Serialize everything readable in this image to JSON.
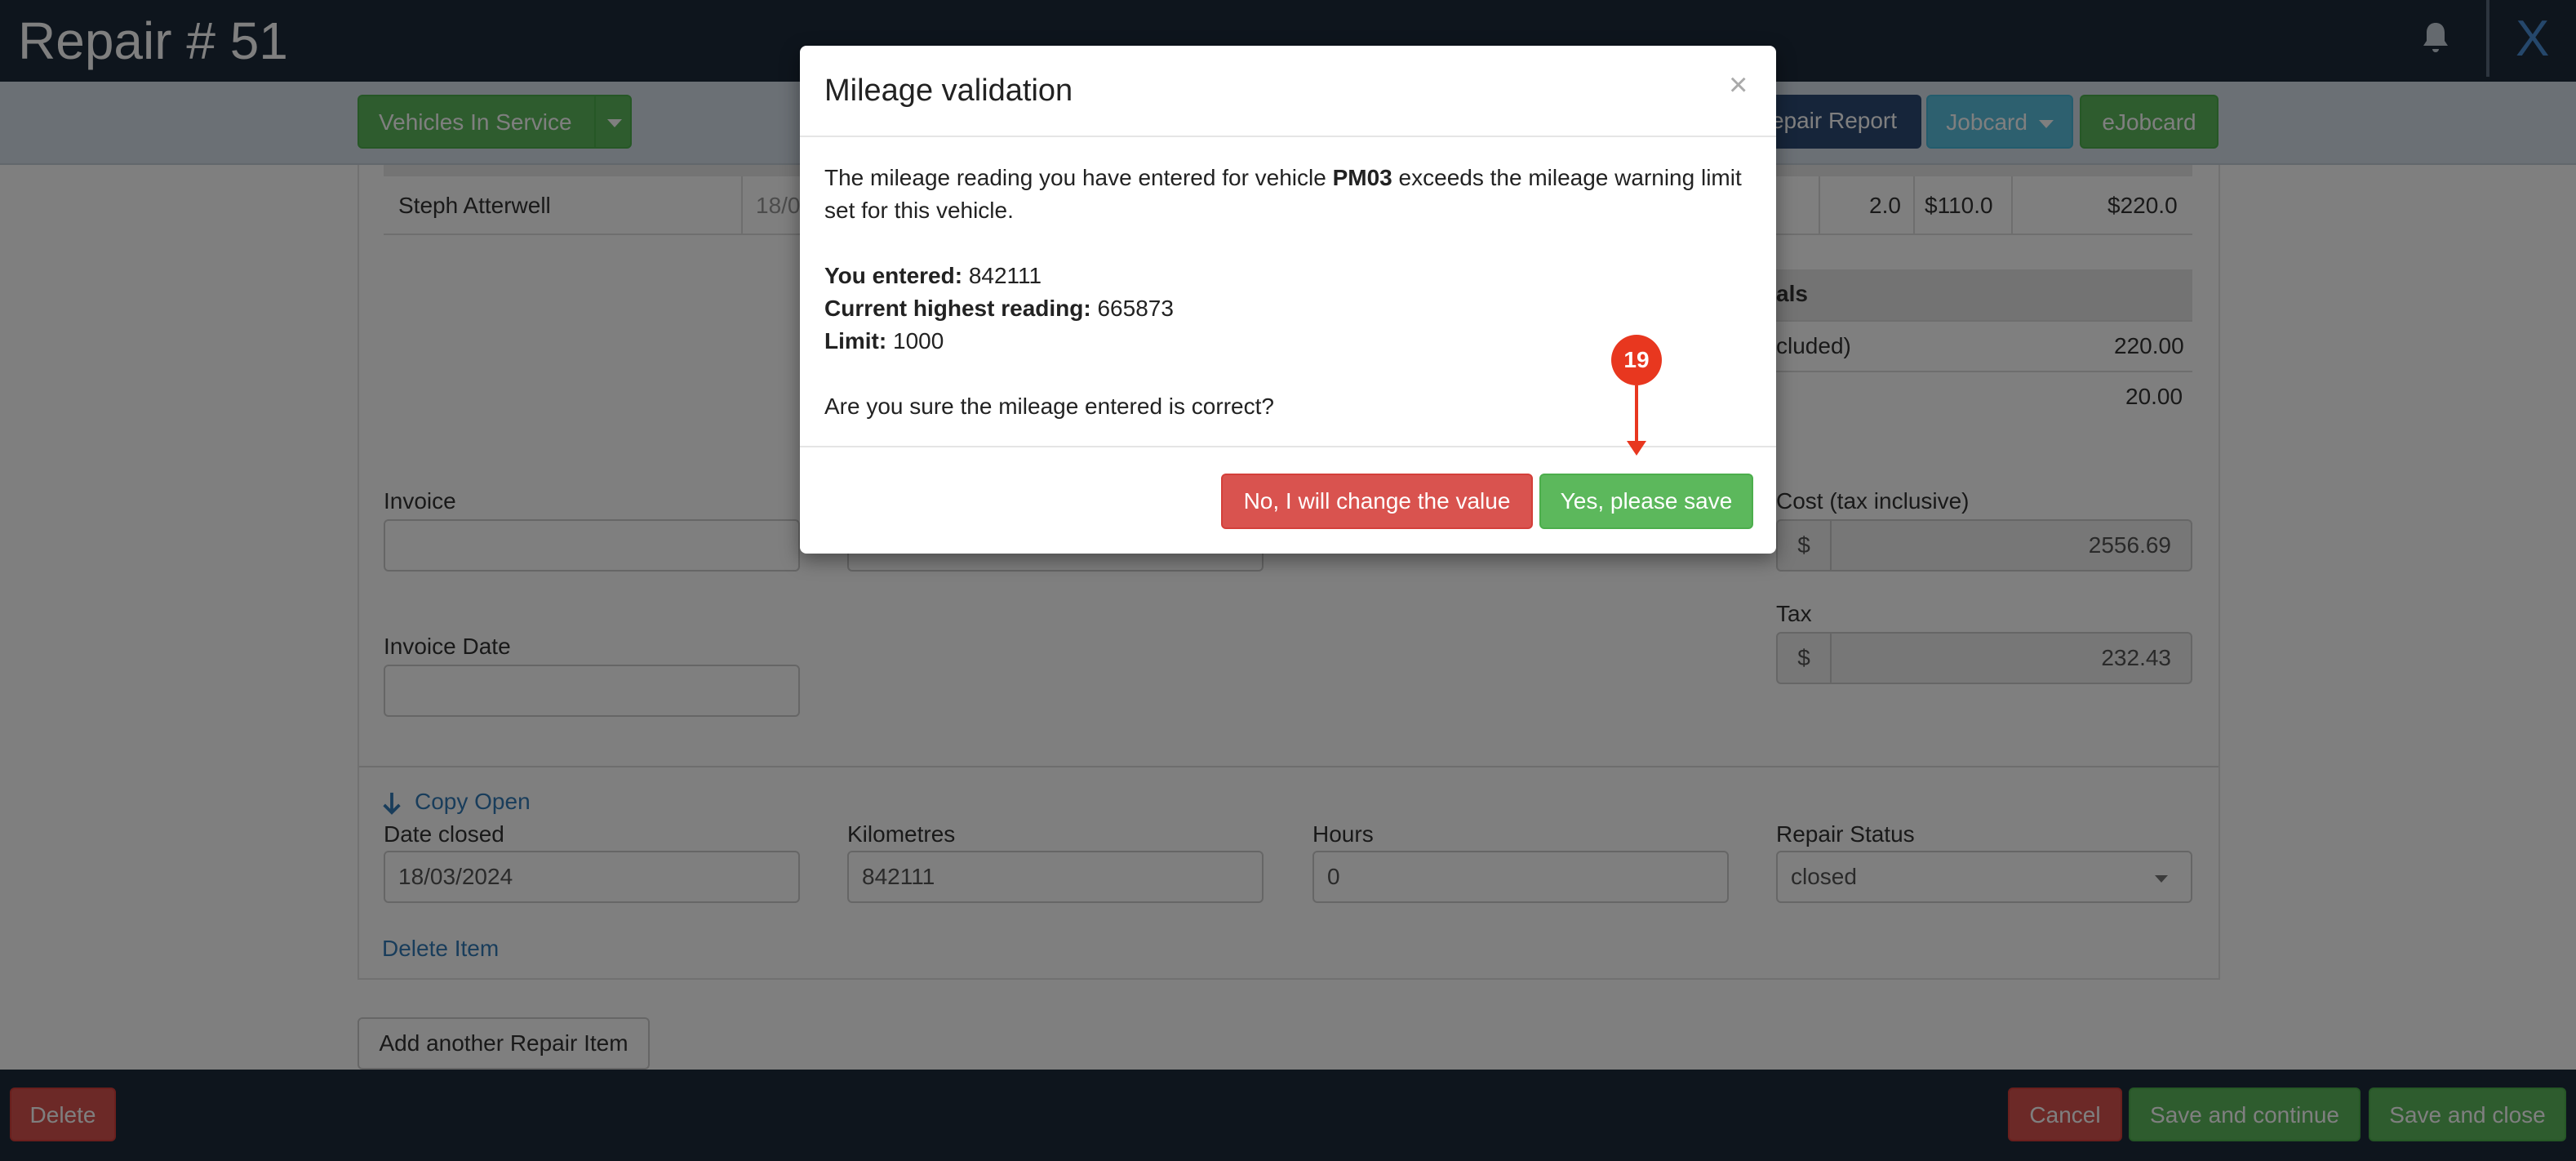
{
  "header": {
    "title": "Repair # 51",
    "close_label": "X"
  },
  "toolbar": {
    "vehicles_in_service": "Vehicles In Service",
    "repair_report": "epair Report",
    "jobcard": "Jobcard",
    "ejobcard": "eJobcard"
  },
  "labour_row": {
    "name": "Steph Atterwell",
    "date": "18/0",
    "qty": "2.0",
    "rate": "$110.0",
    "total": "$220.0"
  },
  "totals": {
    "header": "als",
    "row1_label": "cluded)",
    "row1_value": "220.00",
    "row2_value": "20.00"
  },
  "invoice": {
    "invoice_label": "Invoice",
    "invoice_date_label": "Invoice Date",
    "invoice_value": "",
    "invoice_date_value": ""
  },
  "cost": {
    "label": "Cost (tax inclusive)",
    "currency": "$",
    "value": "2556.69"
  },
  "tax": {
    "label": "Tax",
    "currency": "$",
    "value": "232.43"
  },
  "closed_section": {
    "copy_open": "Copy Open",
    "date_closed_label": "Date closed",
    "date_closed_value": "18/03/2024",
    "km_label": "Kilometres",
    "km_value": "842111",
    "hours_label": "Hours",
    "hours_value": "0",
    "status_label": "Repair Status",
    "status_value": "closed",
    "delete_item": "Delete Item"
  },
  "add_item": "Add another Repair Item",
  "footer": {
    "delete": "Delete",
    "cancel": "Cancel",
    "save_continue": "Save and continue",
    "save_close": "Save and close"
  },
  "modal": {
    "title": "Mileage validation",
    "close": "×",
    "line1_pre": "The mileage reading you have entered for vehicle ",
    "vehicle": "PM03",
    "line1_post": " exceeds the mileage warning limit",
    "line2": "set for this vehicle.",
    "entered_label": "You entered:",
    "entered_value": "842111",
    "highest_label": "Current highest reading:",
    "highest_value": "665873",
    "limit_label": "Limit:",
    "limit_value": "1000",
    "question": "Are you sure the mileage entered is correct?",
    "no_button": "No, I will change the value",
    "yes_button": "Yes, please save"
  },
  "annotation": {
    "number": "19"
  },
  "colors": {
    "primary_green": "#5cb85c",
    "danger_red": "#d9534f",
    "header_navy": "#1c2a3b",
    "annotation_red": "#e8371f"
  }
}
